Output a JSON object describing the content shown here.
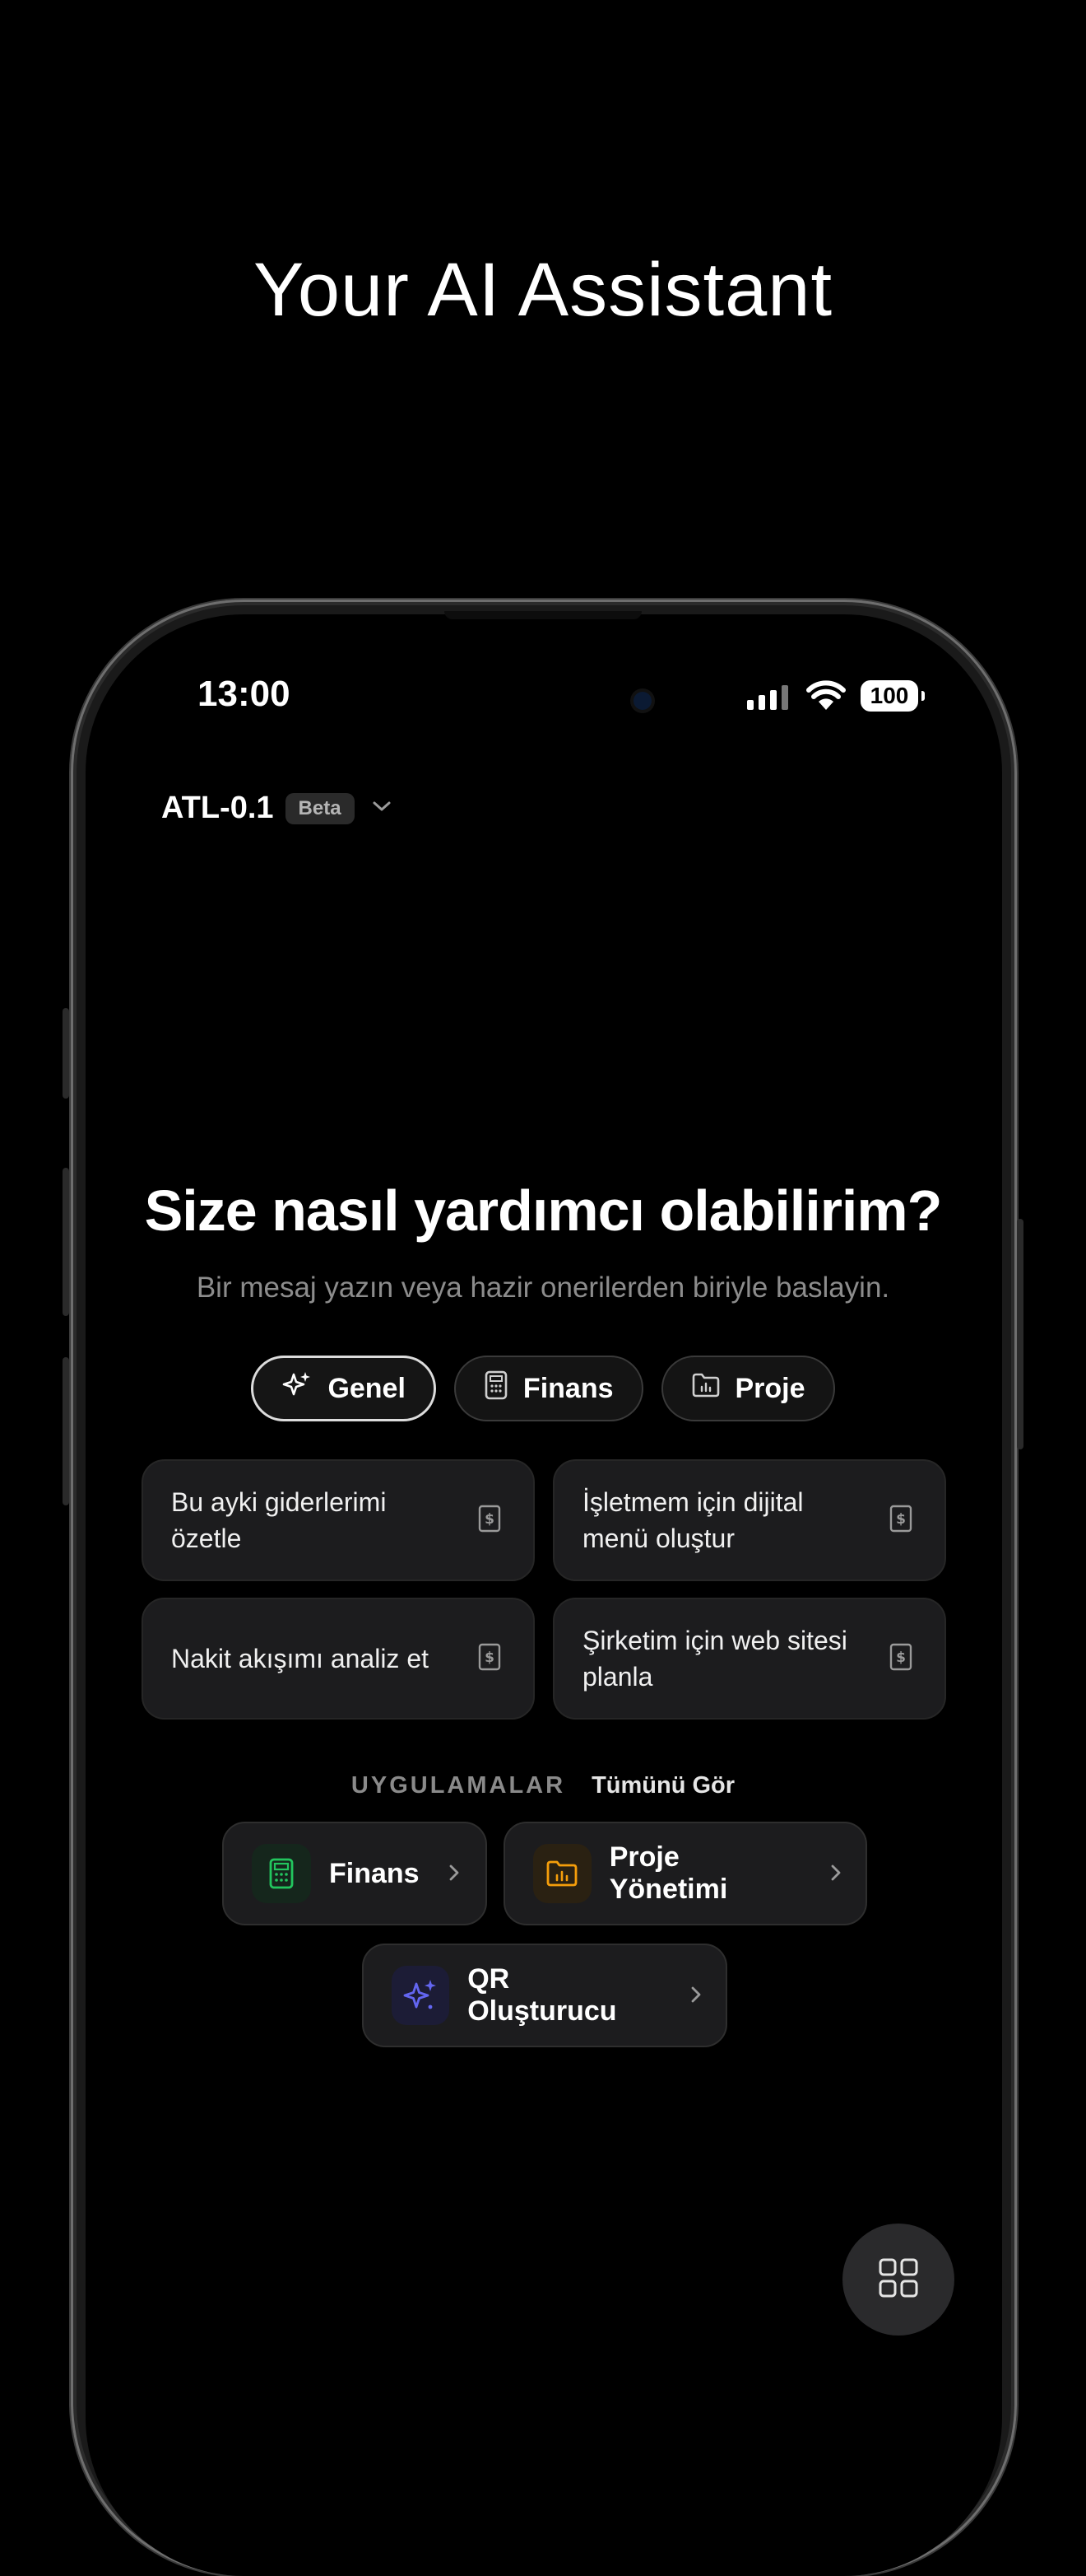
{
  "headline": "Your AI Assistant",
  "status": {
    "time": "13:00",
    "battery": "100"
  },
  "model": {
    "name": "ATL-0.1",
    "badge": "Beta"
  },
  "hero": {
    "title": "Size nasıl yardımcı olabilirim?",
    "subtitle": "Bir mesaj yazın veya hazir onerilerden biriyle baslayin."
  },
  "chips": [
    {
      "label": "Genel",
      "icon": "sparkles-icon",
      "active": true
    },
    {
      "label": "Finans",
      "icon": "calculator-icon",
      "active": false
    },
    {
      "label": "Proje",
      "icon": "folder-chart-icon",
      "active": false
    }
  ],
  "suggestions": [
    {
      "text": "Bu ayki giderlerimi özetle",
      "icon": "dollar-receipt-icon"
    },
    {
      "text": "İşletmem için dijital menü oluştur",
      "icon": "dollar-receipt-icon"
    },
    {
      "text": "Nakit akışımı analiz et",
      "icon": "dollar-receipt-icon"
    },
    {
      "text": "Şirketim için web sitesi planla",
      "icon": "dollar-receipt-icon"
    }
  ],
  "apps": {
    "label": "UYGULAMALAR",
    "see_all": "Tümünü Gör",
    "items": [
      {
        "label": "Finans",
        "icon": "calculator-icon",
        "color": "#22c55e"
      },
      {
        "label": "Proje Yönetimi",
        "icon": "folder-chart-icon",
        "color": "#f59e0b"
      },
      {
        "label": "QR Oluşturucu",
        "icon": "sparkles-icon",
        "color": "#6366f1"
      }
    ]
  }
}
